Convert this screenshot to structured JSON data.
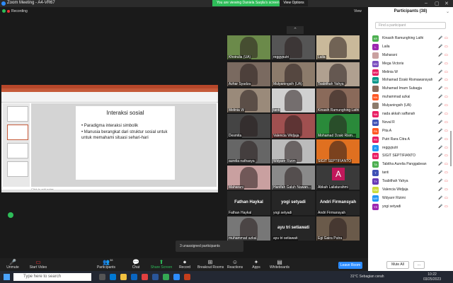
{
  "window": {
    "title": "Zoom Meeting - A4-VR67",
    "recording": "Recording",
    "view": "View"
  },
  "banner": {
    "message": "You are viewing Daniela Saqila's screen",
    "options": "View Options"
  },
  "presentation": {
    "slide_title": "Interaksi sosial",
    "bullets": [
      "• Paradigma interaksi simbolik",
      "• Manusia berangkat dari struktur sosial untuk untuk memahami situasi sehari-hari"
    ],
    "notes": "Click to add notes"
  },
  "gallery": [
    {
      "name": "Khoirulia (UA)",
      "kind": "video",
      "color": "#6b8a4a"
    },
    {
      "name": "reggyputri",
      "kind": "video",
      "color": "#555"
    },
    {
      "name": "Laila",
      "kind": "video",
      "color": "#c9b99a"
    },
    {
      "name": "Azhar Syadza",
      "kind": "video",
      "color": "#7a6a60"
    },
    {
      "name": "Mulyaningsih (UA)",
      "kind": "video",
      "color": "#8c7b6b"
    },
    {
      "name": "Tsabithah Yahya",
      "kind": "video",
      "color": "#b0a090"
    },
    {
      "name": "Melinia W",
      "kind": "video",
      "color": "#9a8a7a"
    },
    {
      "name": "tanti",
      "kind": "video",
      "color": "#d0d0d0"
    },
    {
      "name": "Kinasih Ramunghing Lathi",
      "kind": "video",
      "color": "#8a6a5a"
    },
    {
      "name": "Desmita",
      "kind": "video",
      "color": "#444"
    },
    {
      "name": "Valencia Widjaja",
      "kind": "video",
      "color": "#a05050"
    },
    {
      "name": "Mohamad Dzaki Rism...",
      "kind": "video",
      "color": "#2a8a3a"
    },
    {
      "name": "aurelia nathasya",
      "kind": "video",
      "color": "#666"
    },
    {
      "name": "Wdyarrr Rizim",
      "kind": "video",
      "color": "#bbb"
    },
    {
      "name": "SIGIT SEPTIFIANTO",
      "kind": "video",
      "color": "#e07020"
    },
    {
      "name": "Maharani",
      "kind": "video",
      "color": "#c9a0a0"
    },
    {
      "name": "Hanifah Galuh Nawan...",
      "kind": "video",
      "color": "#8a8a8a"
    },
    {
      "name": "Abkah Lailaturahmi",
      "kind": "avatar",
      "letter": "A"
    },
    {
      "name": "Fathan Haykal",
      "kind": "name",
      "display": "Fathan Haykal"
    },
    {
      "name": "yogi setyadi",
      "kind": "name",
      "display": "yogi setyadi"
    },
    {
      "name": "Andri Firmansyah",
      "kind": "name",
      "display": "Andri Firmansyah"
    },
    {
      "name": "muhammad azkal",
      "kind": "video",
      "color": "#777"
    },
    {
      "name": "ayu tri setiawati",
      "kind": "name",
      "display": "ayu tri setiawati"
    },
    {
      "name": "Egi Gaira Putra",
      "kind": "video",
      "color": "#6a5a4a"
    }
  ],
  "unassigned": "3 unassigned participants",
  "participants_panel": {
    "title": "Participants (38)",
    "search_placeholder": "Find a participant",
    "mute_all": "Mute All",
    "more": "...",
    "items": [
      {
        "initials": "KR",
        "name": "Kinasih Ramunghing Lathi",
        "color": "#4caf50"
      },
      {
        "initials": "L",
        "name": "Laila",
        "color": "#9c27b0"
      },
      {
        "initials": "",
        "name": "Maharani",
        "color": "#c9a0a0"
      },
      {
        "initials": "MV",
        "name": "Mega Victoria",
        "color": "#7b4fbf"
      },
      {
        "initials": "MW",
        "name": "Melinia W",
        "color": "#e91e63"
      },
      {
        "initials": "MD",
        "name": "Mohamad Dzaki Rismawansyah",
        "color": "#009688"
      },
      {
        "initials": "",
        "name": "Muhamad Imam Subagja",
        "color": "#8a6a5a"
      },
      {
        "initials": "MA",
        "name": "muhammad azkal",
        "color": "#ff5722"
      },
      {
        "initials": "",
        "name": "Mulyaningsih (UA)",
        "color": "#8c7b6b"
      },
      {
        "initials": "NA",
        "name": "nada akkah saffanah",
        "color": "#e91e63"
      },
      {
        "initials": "NR",
        "name": "Noval R",
        "color": "#3f51b5"
      },
      {
        "initials": "PA",
        "name": "Pita A",
        "color": "#ff5722"
      },
      {
        "initials": "PR",
        "name": "Putri Rara Citra A",
        "color": "#e91e63"
      },
      {
        "initials": "R",
        "name": "reggyputri",
        "color": "#2196f3"
      },
      {
        "initials": "SS",
        "name": "SIGIT SEPTIFIANTO",
        "color": "#e91e63"
      },
      {
        "initials": "TA",
        "name": "Tabitha Aurelia Panggabean",
        "color": "#4caf50"
      },
      {
        "initials": "T",
        "name": "tanti",
        "color": "#3f51b5"
      },
      {
        "initials": "TY",
        "name": "Tsabithah Yahya",
        "color": "#673ab7"
      },
      {
        "initials": "VW",
        "name": "Valencia Widjaja",
        "color": "#cddc39"
      },
      {
        "initials": "WR",
        "name": "Wdyarrr Rizimi",
        "color": "#2196f3"
      },
      {
        "initials": "YS",
        "name": "yogi setyadi",
        "color": "#9c27b0"
      }
    ]
  },
  "toolbar": {
    "unmute": "Unmute",
    "start_video": "Start Video",
    "participants": "Participants",
    "participant_count": "38",
    "chat": "Chat",
    "share_screen": "Share Screen",
    "record": "Record",
    "breakout_rooms": "Breakout Rooms",
    "reactions": "Reactions",
    "apps": "Apps",
    "whiteboards": "Whiteboards",
    "end": "Leave Room"
  },
  "taskbar": {
    "search_placeholder": "Type here to search",
    "weather": "31°C  Sebagian cerah",
    "time": "10:22",
    "date": "03/25/2023"
  }
}
